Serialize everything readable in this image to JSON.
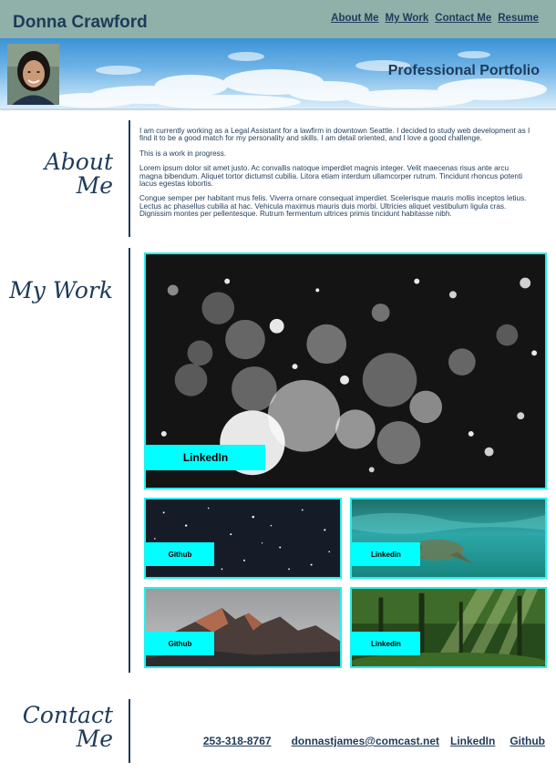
{
  "header": {
    "name": "Donna Crawford",
    "nav": [
      "About Me",
      "My Work",
      "Contact Me",
      "Resume"
    ]
  },
  "hero": {
    "title": "Professional Portfolio",
    "avatar_icon": "avatar-photo"
  },
  "about": {
    "title_line1": "About",
    "title_line2": "Me",
    "paragraphs": [
      "I am currently working as a Legal Assistant for a lawfirm in downtown Seattle. I decided to study web development as I find it to be a good match for my personality and skills. I am detail oriented, and I love a good challenge.",
      "This is a work in progress.",
      "Lorem ipsum dolor sit amet justo. Ac convallis natoque imperdiet magnis integer. Velit maecenas risus ante arcu magna bibendum. Aliquet tortor dictumst cubilia. Litora etiam interdum ullamcorper rutrum. Tincidunt rhoncus potenti lacus egestas lobortis.",
      "Congue semper per habitant mus felis. Viverra ornare consequat imperdiet. Scelerisque mauris mollis inceptos letius. Lectus ac phasellus cubilia at hac. Vehicula maximus mauris duis morbi. Ultricies aliquet vestibulum ligula cras. Dignissim montes per pellentesque. Rutrum fermentum ultrices primis tincidunt habitasse nibh."
    ]
  },
  "work": {
    "title": "My Work",
    "tiles": [
      {
        "label": "LinkedIn",
        "image": "snow-bokeh"
      },
      {
        "label": "Github",
        "image": "starry-night"
      },
      {
        "label": "Linkedin",
        "image": "underwater-turtle"
      },
      {
        "label": "Github",
        "image": "mountain-peaks"
      },
      {
        "label": "Linkedin",
        "image": "forest-sunbeams"
      }
    ]
  },
  "contact": {
    "title_line1": "Contact",
    "title_line2": "Me",
    "links": [
      "253-318-8767",
      "donnastjames@comcast.net",
      "LinkedIn",
      "Github"
    ]
  },
  "colors": {
    "header_bg": "#8fb1aa",
    "text": "#1e3b5a",
    "accent": "#00ffff"
  }
}
